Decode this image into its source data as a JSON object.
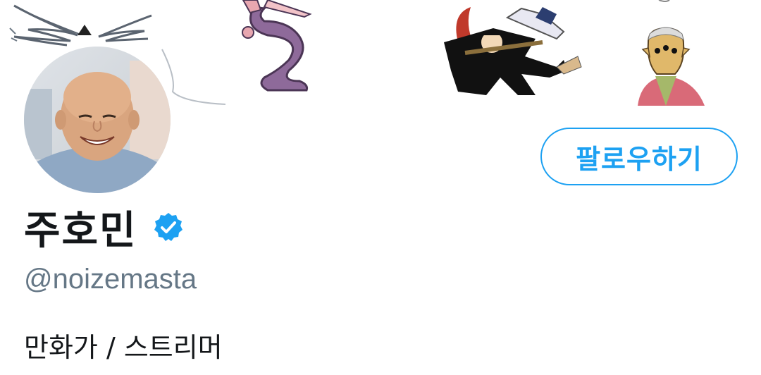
{
  "profile": {
    "display_name": "주호민",
    "handle": "@noizemasta",
    "bio": "만화가 / 스트리머",
    "verified": true,
    "follow_label": "팔로우하기"
  },
  "colors": {
    "accent": "#1DA1F2",
    "name_text": "#14171a",
    "handle_text": "#657786"
  },
  "icons": {
    "verified": "verified-badge-icon"
  }
}
